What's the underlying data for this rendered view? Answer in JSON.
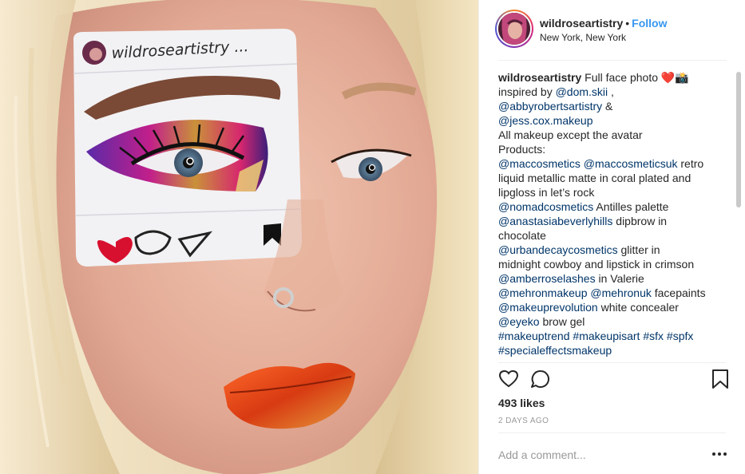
{
  "post": {
    "username": "wildroseartistry",
    "separator": "•",
    "follow_label": "Follow",
    "location": "New York, New York",
    "likes": "493 likes",
    "timestamp": "2 DAYS AGO",
    "comment_placeholder": "Add a comment..."
  },
  "photo": {
    "painted_username": "wildroseartistry ..."
  },
  "caption": {
    "lines": [
      [
        {
          "t": "wildroseartistry",
          "k": "name"
        },
        {
          "t": " Full face photo ❤️📸",
          "k": "text"
        }
      ],
      [
        {
          "t": "inspired by ",
          "k": "text"
        },
        {
          "t": "@dom.skii",
          "k": "tag"
        },
        {
          "t": " ,",
          "k": "text"
        }
      ],
      [
        {
          "t": "@abbyrobertsartistry",
          "k": "tag"
        },
        {
          "t": " &",
          "k": "text"
        }
      ],
      [
        {
          "t": "@jess.cox.makeup",
          "k": "tag"
        }
      ],
      [
        {
          "t": "All makeup except the avatar",
          "k": "text"
        }
      ],
      [
        {
          "t": "Products:",
          "k": "text"
        }
      ],
      [
        {
          "t": "@maccosmetics",
          "k": "tag"
        },
        {
          "t": " ",
          "k": "text"
        },
        {
          "t": "@maccosmeticsuk",
          "k": "tag"
        },
        {
          "t": " retro",
          "k": "text"
        }
      ],
      [
        {
          "t": "liquid metallic matte in coral plated and",
          "k": "text"
        }
      ],
      [
        {
          "t": "lipgloss in let’s rock",
          "k": "text"
        }
      ],
      [
        {
          "t": "@nomadcosmetics",
          "k": "tag"
        },
        {
          "t": " Antilles palette",
          "k": "text"
        }
      ],
      [
        {
          "t": "@anastasiabeverlyhills",
          "k": "tag"
        },
        {
          "t": " dipbrow in",
          "k": "text"
        }
      ],
      [
        {
          "t": "chocolate",
          "k": "text"
        }
      ],
      [
        {
          "t": "@urbandecaycosmetics",
          "k": "tag"
        },
        {
          "t": " glitter in",
          "k": "text"
        }
      ],
      [
        {
          "t": "midnight cowboy and lipstick in crimson",
          "k": "text"
        }
      ],
      [
        {
          "t": "@amberroselashes",
          "k": "tag"
        },
        {
          "t": " in Valerie",
          "k": "text"
        }
      ],
      [
        {
          "t": "@mehronmakeup",
          "k": "tag"
        },
        {
          "t": " ",
          "k": "text"
        },
        {
          "t": "@mehronuk",
          "k": "tag"
        },
        {
          "t": " facepaints",
          "k": "text"
        }
      ],
      [
        {
          "t": "@makeuprevolution",
          "k": "tag"
        },
        {
          "t": " white concealer",
          "k": "text"
        }
      ],
      [
        {
          "t": "@eyeko",
          "k": "tag"
        },
        {
          "t": " brow gel",
          "k": "text"
        }
      ],
      [
        {
          "t": "#makeuptrend",
          "k": "tag"
        },
        {
          "t": " ",
          "k": "text"
        },
        {
          "t": "#makeupisart",
          "k": "tag"
        },
        {
          "t": " ",
          "k": "text"
        },
        {
          "t": "#sfx",
          "k": "tag"
        },
        {
          "t": " ",
          "k": "text"
        },
        {
          "t": "#spfx",
          "k": "tag"
        }
      ],
      [
        {
          "t": "#specialeffectsmakeup",
          "k": "tag"
        }
      ]
    ]
  },
  "icons": {
    "like": "heart-outline-icon",
    "comment": "speech-bubble-icon",
    "save": "bookmark-icon",
    "more": "more-options-icon"
  },
  "colors": {
    "link": "#003569",
    "follow": "#3897f0",
    "muted": "#999999",
    "divider": "#efefef"
  }
}
